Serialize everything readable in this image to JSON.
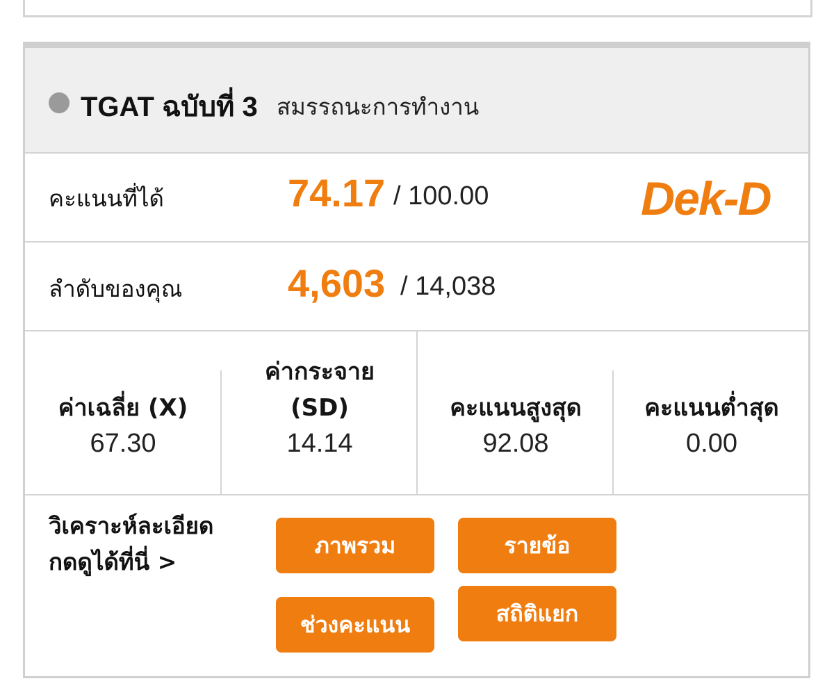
{
  "section": {
    "title": "TGAT ฉบับที่ 3",
    "subtitle": "สมรรถนะการทำงาน"
  },
  "score": {
    "label": "คะแนนที่ได้",
    "value": "74.17",
    "total": "/ 100.00"
  },
  "rank": {
    "label": "ลำดับของคุณ",
    "value": "4,603",
    "total": "/ 14,038"
  },
  "brand": {
    "logo": "Dek-D",
    "accent_color": "#f07d10"
  },
  "stats": [
    {
      "label_line1": "ค่าเฉลี่ย (X)",
      "label_line2": "",
      "value": "67.30"
    },
    {
      "label_line1": "ค่ากระจาย",
      "label_line2": "(SD)",
      "value": "14.14"
    },
    {
      "label_line1": "คะแนนสูงสุด",
      "label_line2": "",
      "value": "92.08"
    },
    {
      "label_line1": "คะแนนต่ำสุด",
      "label_line2": "",
      "value": "0.00"
    }
  ],
  "analysis": {
    "line1": "วิเคราะห์ละเอียด",
    "line2": "กดดูได้ที่นี่ >",
    "buttons": {
      "overview": "ภาพรวม",
      "by_item": "รายข้อ",
      "score_range": "ช่วงคะแนน",
      "stats_breakdown": "สถิติแยก"
    }
  }
}
